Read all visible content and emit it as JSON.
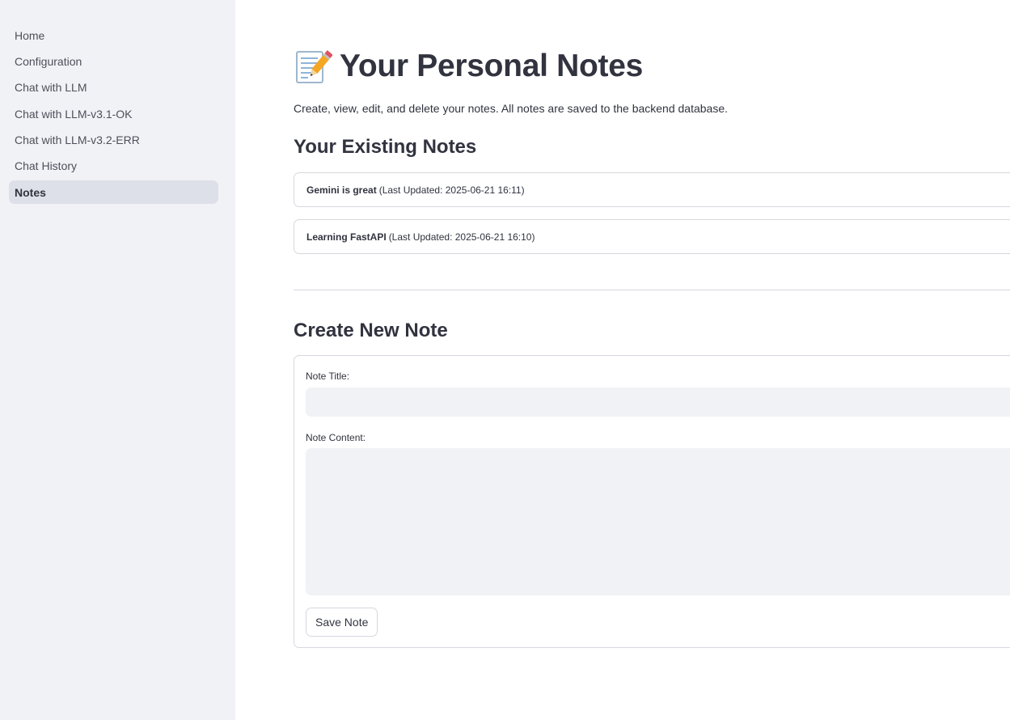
{
  "sidebar": {
    "items": [
      {
        "label": "Home"
      },
      {
        "label": "Configuration"
      },
      {
        "label": "Chat with LLM"
      },
      {
        "label": "Chat with LLM-v3.1-OK"
      },
      {
        "label": "Chat with LLM-v3.2-ERR"
      },
      {
        "label": "Chat History"
      },
      {
        "label": "Notes",
        "active": true
      }
    ]
  },
  "main": {
    "title_icon": "memo-pencil-icon",
    "title": "Your Personal Notes",
    "subtitle": "Create, view, edit, and delete your notes. All notes are saved to the backend database.",
    "existing_heading": "Your Existing Notes",
    "notes": [
      {
        "title": "Gemini is great",
        "meta": "(Last Updated: 2025-06-21 16:11)"
      },
      {
        "title": "Learning FastAPI",
        "meta": "(Last Updated: 2025-06-21 16:10)"
      }
    ],
    "create_heading": "Create New Note",
    "form": {
      "title_label": "Note Title:",
      "title_value": "",
      "content_label": "Note Content:",
      "content_value": "",
      "save_label": "Save Note"
    }
  },
  "colors": {
    "sidebar_bg": "#f0f2f6",
    "active_item_bg": "#dde0e8",
    "text": "#31333f",
    "border": "#d6d8de",
    "input_bg": "#f0f2f6"
  }
}
